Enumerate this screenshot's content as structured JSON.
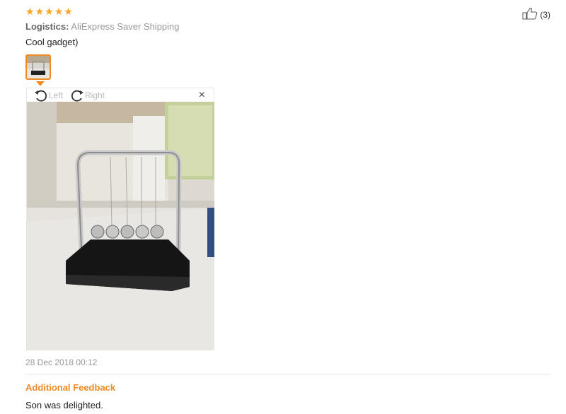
{
  "review": {
    "rating": 5,
    "logistics_label": "Logistics:",
    "logistics_value": "AliExpress Saver Shipping",
    "comment": "Cool gadget)",
    "helpful_count": "(3)",
    "date": "28 Dec 2018 00:12"
  },
  "viewer": {
    "rotate_left": "Left",
    "rotate_right": "Right",
    "close": "×"
  },
  "additional": {
    "title": "Additional Feedback",
    "text": "Son was delighted."
  },
  "colors": {
    "accent": "#f08a24",
    "star": "#f5a623"
  },
  "icons": [
    "star-icon",
    "thumbs-up-icon",
    "rotate-left-icon",
    "rotate-right-icon",
    "close-icon"
  ]
}
